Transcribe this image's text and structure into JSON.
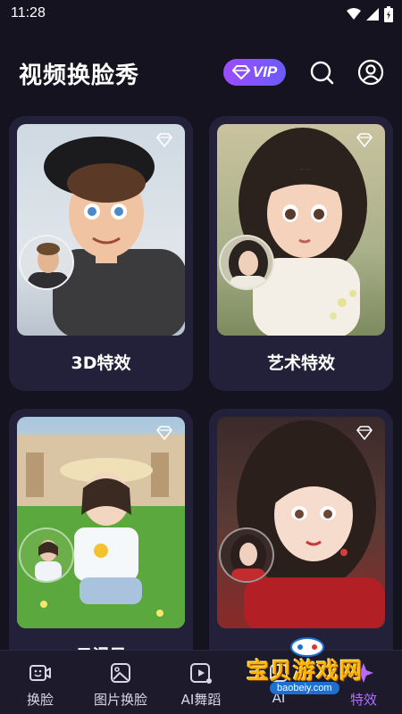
{
  "status_bar": {
    "time": "11:28"
  },
  "header": {
    "title": "视频换脸秀",
    "vip_label": "VIP"
  },
  "cards": [
    {
      "label": "3D特效"
    },
    {
      "label": "艺术特效"
    },
    {
      "label": "日漫风"
    },
    {
      "label": ""
    }
  ],
  "bottom_nav": {
    "items": [
      {
        "label": "换脸",
        "icon": "video-face-icon"
      },
      {
        "label": "图片换脸",
        "icon": "image-face-icon"
      },
      {
        "label": "AI舞蹈",
        "icon": "ai-dance-icon"
      },
      {
        "label": "AI",
        "icon": "ai-icon"
      },
      {
        "label": "特效",
        "icon": "effects-icon"
      }
    ]
  },
  "watermark": {
    "text": "宝贝游戏网",
    "url": "baobeiy.com"
  },
  "colors": {
    "background": "#15131f",
    "card": "#23213a",
    "accent": "#a855f7",
    "nav_bg": "#1d1b2b"
  }
}
